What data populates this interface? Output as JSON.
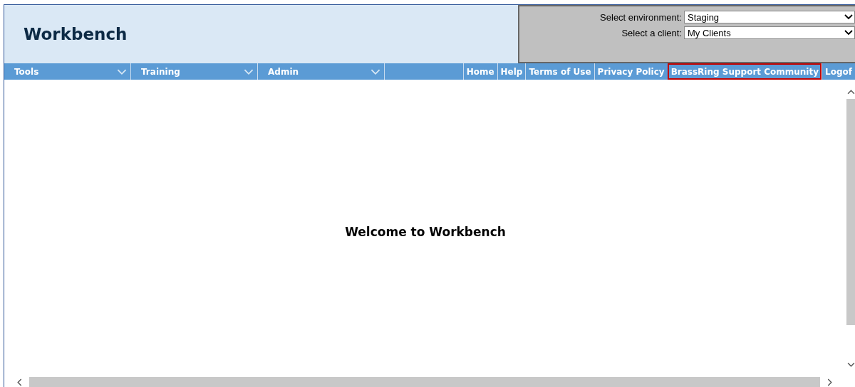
{
  "header": {
    "title": "Workbench",
    "selectors": [
      {
        "label": "Select environment:",
        "value": "Staging"
      },
      {
        "label": "Select a client:",
        "value": "My Clients"
      }
    ]
  },
  "menus": [
    {
      "label": "Tools"
    },
    {
      "label": "Training"
    },
    {
      "label": "Admin"
    }
  ],
  "links": [
    {
      "label": "Home",
      "highlighted": false
    },
    {
      "label": "Help",
      "highlighted": false
    },
    {
      "label": "Terms of Use",
      "highlighted": false
    },
    {
      "label": "Privacy Policy",
      "highlighted": false
    },
    {
      "label": "BrassRing Support Community",
      "highlighted": true
    },
    {
      "label": "Logof",
      "highlighted": false
    }
  ],
  "content": {
    "welcome": "Welcome to Workbench"
  }
}
